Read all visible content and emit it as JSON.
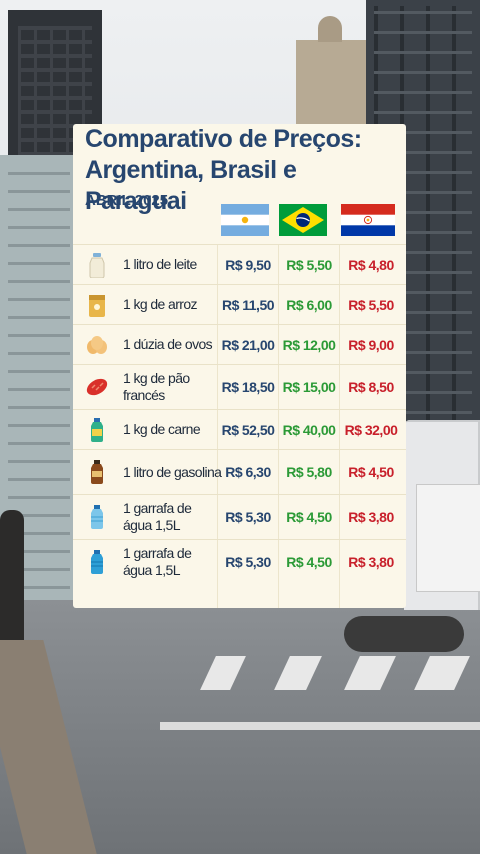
{
  "card": {
    "title_line1": "Comparativo de Preços:",
    "title_line2": "Argentina, Brasil e Paraguai",
    "subtitle": "ABRIL 2025"
  },
  "colors": {
    "title": "#27466f",
    "argentina_price": "#27466f",
    "brasil_price": "#2b9a36",
    "paraguai_price": "#c8202b",
    "card_background": "#fbf7e9"
  },
  "flags": [
    "argentina-flag-icon",
    "brasil-flag-icon",
    "paraguai-flag-icon"
  ],
  "rows": [
    {
      "icon": "milk-bottle-icon",
      "name": "1 litro de leite",
      "ar": "R$ 9,50",
      "br": "R$ 5,50",
      "py": "R$ 4,80"
    },
    {
      "icon": "rice-bag-icon",
      "name": "1 kg de arroz",
      "ar": "R$ 11,50",
      "br": "R$ 6,00",
      "py": "R$ 5,50"
    },
    {
      "icon": "eggs-icon",
      "name": "1 dúzia de ovos",
      "ar": "R$ 21,00",
      "br": "R$ 12,00",
      "py": "R$ 9,00"
    },
    {
      "icon": "bread-icon",
      "name": "1 kg de pão francés",
      "ar": "R$ 18,50",
      "br": "R$ 15,00",
      "py": "R$ 8,50"
    },
    {
      "icon": "meat-bottle-icon",
      "name": "1 kg de carne",
      "ar": "R$ 52,50",
      "br": "R$ 40,00",
      "py": "R$ 32,00"
    },
    {
      "icon": "gasoline-bottle-icon",
      "name": "1 litro de gasolina",
      "ar": "R$ 6,30",
      "br": "R$ 5,80",
      "py": "R$ 4,50"
    },
    {
      "icon": "water-bottle-icon",
      "name": "1 garrafa de água 1,5L",
      "ar": "R$ 5,30",
      "br": "R$ 4,50",
      "py": "R$ 3,80"
    },
    {
      "icon": "water-bottle-icon",
      "name": "1 garrafa de água 1,5L",
      "ar": "R$ 5,30",
      "br": "R$ 4,50",
      "py": "R$ 3,80"
    }
  ]
}
